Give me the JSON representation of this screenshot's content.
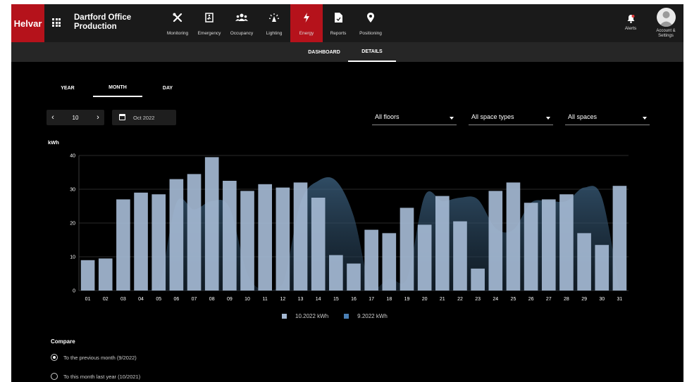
{
  "brand": {
    "logo": "Helvar",
    "accent": "#b5121b"
  },
  "site": {
    "title_line1": "Dartford Office",
    "title_line2": "Production"
  },
  "nav": {
    "items": [
      {
        "label": "Monitoring",
        "icon": "tools-icon"
      },
      {
        "label": "Emergency",
        "icon": "emergency-exit-icon"
      },
      {
        "label": "Occupancy",
        "icon": "people-icon"
      },
      {
        "label": "Lighting",
        "icon": "light-icon"
      },
      {
        "label": "Energy",
        "icon": "lightning-icon",
        "active": true
      },
      {
        "label": "Reports",
        "icon": "report-icon"
      },
      {
        "label": "Positioning",
        "icon": "location-pin-icon"
      }
    ],
    "alerts_label": "Alerts",
    "account_label_line1": "Account &",
    "account_label_line2": "Settings"
  },
  "subtabs": [
    {
      "label": "DASHBOARD",
      "active": false
    },
    {
      "label": "DETAILS",
      "active": true
    }
  ],
  "period_tabs": [
    {
      "label": "YEAR",
      "active": false
    },
    {
      "label": "MONTH",
      "active": true
    },
    {
      "label": "DAY",
      "active": false
    }
  ],
  "stepper": {
    "value": "10"
  },
  "date_picker": {
    "value": "Oct 2022"
  },
  "filters": {
    "floors": "All floors",
    "space_types": "All space types",
    "spaces": "All spaces"
  },
  "chart_data": {
    "type": "bar",
    "ylabel": "kWh",
    "ylim": [
      0,
      40
    ],
    "yticks": [
      "0",
      "10",
      "20",
      "30",
      "40"
    ],
    "categories": [
      "01",
      "02",
      "03",
      "04",
      "05",
      "06",
      "07",
      "08",
      "09",
      "10",
      "11",
      "12",
      "13",
      "14",
      "15",
      "16",
      "17",
      "18",
      "19",
      "20",
      "21",
      "22",
      "23",
      "24",
      "25",
      "26",
      "27",
      "28",
      "29",
      "30",
      "31"
    ],
    "series": [
      {
        "name": "10.2022 kWh",
        "kind": "bar",
        "color": "#a4b8d2",
        "values": [
          9,
          9.5,
          27,
          29,
          28.5,
          33,
          34.5,
          39.5,
          32.5,
          29.5,
          31.5,
          30.5,
          32,
          27.5,
          10.5,
          8,
          18,
          17,
          24.5,
          19.5,
          28,
          20.5,
          6.5,
          29.5,
          32,
          26,
          27,
          28.5,
          17,
          13.5,
          31
        ]
      },
      {
        "name": "9.2022 kWh",
        "kind": "area",
        "color": "#4a7fb5",
        "values": [
          0,
          0,
          0,
          0,
          1,
          26,
          24,
          26.5,
          24.5,
          5,
          0,
          2,
          26,
          32.5,
          32.5,
          22,
          0,
          3.5,
          3.5,
          28,
          26.5,
          27.5,
          27,
          18.5,
          18,
          26,
          26.5,
          26.5,
          30.5,
          27.5,
          0
        ]
      }
    ]
  },
  "compare": {
    "title": "Compare",
    "options": [
      {
        "label": "To the previous month (9/2022)",
        "selected": true
      },
      {
        "label": "To this month last year (10/2021)",
        "selected": false
      }
    ]
  }
}
